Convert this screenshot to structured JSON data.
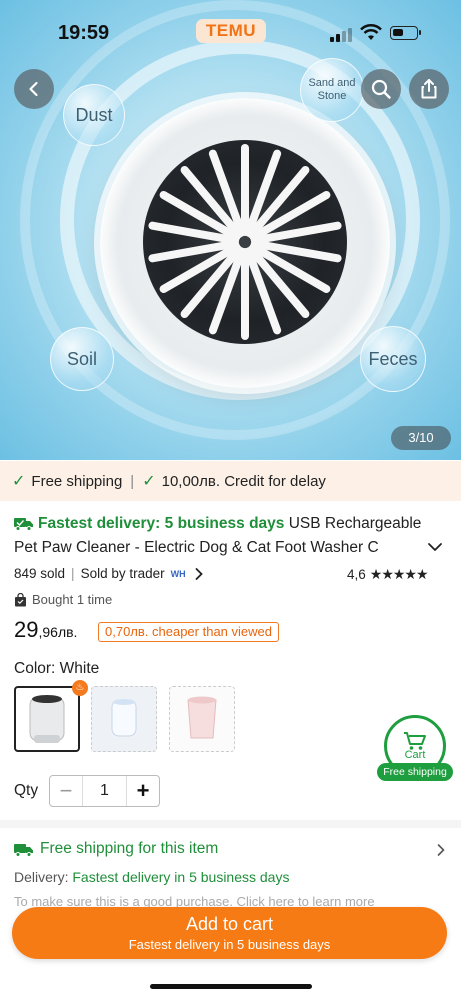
{
  "status_bar": {
    "time": "19:59",
    "app_logo": "TEMU"
  },
  "gallery": {
    "labels": {
      "dust": "Dust",
      "sand_stone": "Sand and Stone",
      "soil": "Soil",
      "feces": "Feces"
    },
    "counter": "3/10"
  },
  "banner": {
    "free_shipping": "Free shipping",
    "credit": "10,00лв. Credit for delay"
  },
  "product": {
    "fastest_delivery": "Fastest delivery: 5 business days",
    "title_part1": "USB Rechargeable",
    "title_part2": "Pet Paw Cleaner - Electric Dog & Cat Foot Washer C",
    "sold": "849 sold",
    "sold_by": "Sold by trader",
    "badge": "WH",
    "rating": "4,6",
    "bought": "Bought 1 time",
    "price_main": "29",
    "price_cents": ",96лв.",
    "cheaper": "0,70лв. cheaper than viewed"
  },
  "color": {
    "label": "Color: White"
  },
  "floating_cart": {
    "label": "Cart",
    "badge": "Free shipping"
  },
  "quantity": {
    "label": "Qty",
    "value": "1",
    "minus": "−",
    "plus": "+"
  },
  "shipping": {
    "title": "Free shipping for this item",
    "delivery_prefix": "Delivery:",
    "delivery_value": "Fastest delivery in 5 business days",
    "faded": "To make sure this is a good purchase. Click here to learn more"
  },
  "cta": {
    "label": "Add to cart",
    "sub": "Fastest delivery in 5 business days"
  },
  "colors": {
    "accent": "#f77b14",
    "green": "#1f8f3a"
  },
  "icons": [
    "back-arrow-icon",
    "search-icon",
    "share-icon",
    "truck-icon",
    "check-icon",
    "chevron-down-icon",
    "chevron-right-icon",
    "bag-icon",
    "cart-icon",
    "fire-icon"
  ]
}
